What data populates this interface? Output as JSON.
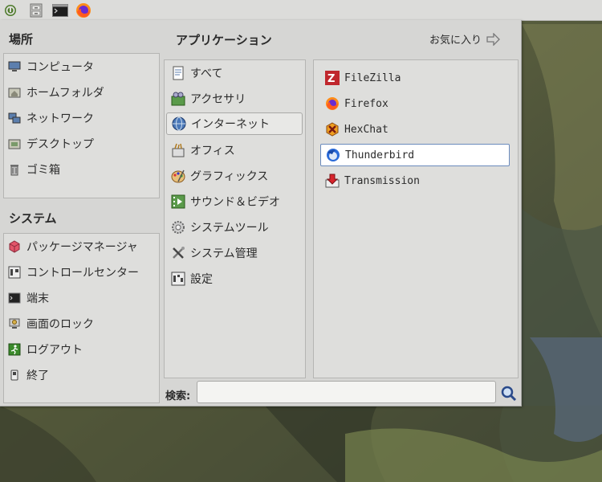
{
  "places": {
    "title": "場所",
    "items": [
      {
        "label": "コンピュータ",
        "icon": "computer-icon"
      },
      {
        "label": "ホームフォルダ",
        "icon": "home-folder-icon"
      },
      {
        "label": "ネットワーク",
        "icon": "network-icon"
      },
      {
        "label": "デスクトップ",
        "icon": "desktop-folder-icon"
      },
      {
        "label": "ゴミ箱",
        "icon": "trash-icon"
      }
    ]
  },
  "system": {
    "title": "システム",
    "items": [
      {
        "label": "パッケージマネージャ",
        "icon": "package-manager-icon"
      },
      {
        "label": "コントロールセンター",
        "icon": "control-center-icon"
      },
      {
        "label": "端末",
        "icon": "terminal-icon"
      },
      {
        "label": "画面のロック",
        "icon": "lock-screen-icon"
      },
      {
        "label": "ログアウト",
        "icon": "logout-icon"
      },
      {
        "label": "終了",
        "icon": "shutdown-icon"
      }
    ]
  },
  "applications": {
    "title": "アプリケーション",
    "favorites_label": "お気に入り",
    "categories": [
      {
        "label": "すべて",
        "icon": "all-applications-icon"
      },
      {
        "label": "アクセサリ",
        "icon": "accessories-icon"
      },
      {
        "label": "インターネット",
        "icon": "internet-icon",
        "selected": true
      },
      {
        "label": "オフィス",
        "icon": "office-icon"
      },
      {
        "label": "グラフィックス",
        "icon": "graphics-icon"
      },
      {
        "label": "サウンド＆ビデオ",
        "icon": "sound-video-icon"
      },
      {
        "label": "システムツール",
        "icon": "system-tools-icon"
      },
      {
        "label": "システム管理",
        "icon": "system-admin-icon"
      },
      {
        "label": "設定",
        "icon": "settings-icon"
      }
    ],
    "apps": [
      {
        "label": "FileZilla",
        "icon": "filezilla-icon"
      },
      {
        "label": "Firefox",
        "icon": "firefox-icon"
      },
      {
        "label": "HexChat",
        "icon": "hexchat-icon"
      },
      {
        "label": "Thunderbird",
        "icon": "thunderbird-icon",
        "focused": true
      },
      {
        "label": "Transmission",
        "icon": "transmission-icon"
      }
    ]
  },
  "search": {
    "label": "検索:",
    "value": "",
    "placeholder": ""
  },
  "colors": {
    "panel": "#dcdcda",
    "menu_bg": "#d6d6d4",
    "focus_border": "#6b8bbd"
  }
}
